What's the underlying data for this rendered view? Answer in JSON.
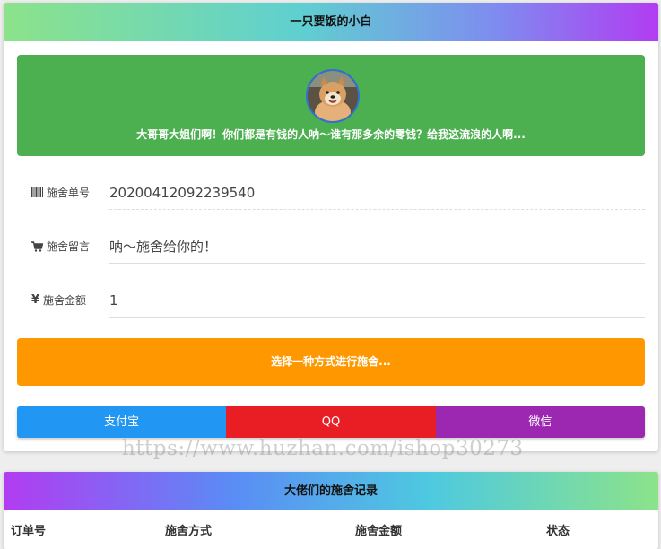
{
  "header": {
    "title": "一只要饭的小白"
  },
  "banner": {
    "motto": "大哥哥大姐们啊！你们都是有钱的人呐～谁有那多余的零钱？给我这流浪的人啊..."
  },
  "form": {
    "order": {
      "label": "施舍单号",
      "icon": "barcode-icon",
      "value": "20200412092239540"
    },
    "message": {
      "label": "施舍留言",
      "icon": "cart-icon",
      "value": "呐～施舍给你的！"
    },
    "amount": {
      "label": "施舍金额",
      "icon": "yen-icon",
      "value": "1"
    }
  },
  "choose_label": "选择一种方式进行施舍...",
  "payment": {
    "alipay": "支付宝",
    "qq": "QQ",
    "wechat": "微信"
  },
  "watermark": "https://www.huzhan.com/ishop30273",
  "records": {
    "title": "大佬们的施舍记录",
    "columns": [
      "订单号",
      "施舍方式",
      "施舍金额",
      "状态"
    ]
  },
  "colors": {
    "banner": "#4caf50",
    "choose": "#ff9800",
    "alipay": "#2196f3",
    "qq": "#e91e24",
    "wechat": "#9c27b0"
  }
}
